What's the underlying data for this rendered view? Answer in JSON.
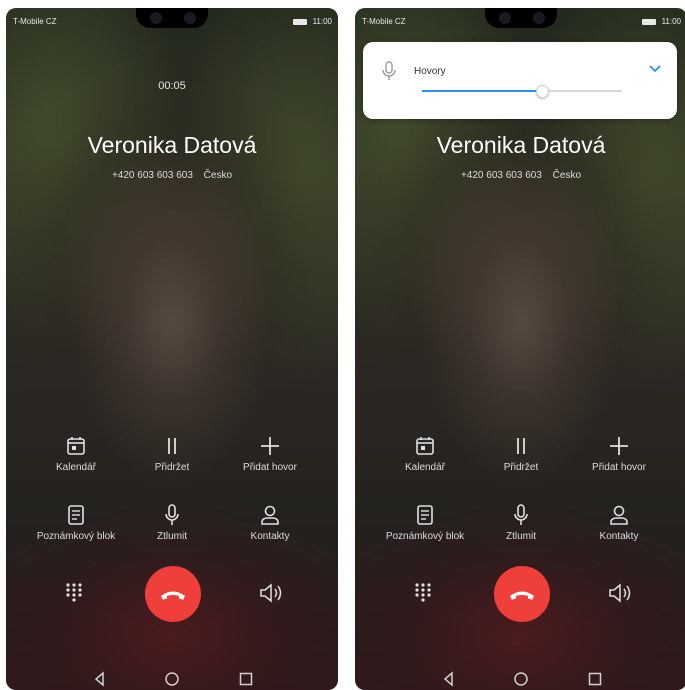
{
  "status": {
    "carrier": "T-Mobile CZ",
    "time": "11:00"
  },
  "call": {
    "timer": "00:05",
    "name": "Veronika Datová",
    "number": "+420 603 603 603",
    "country": "Česko"
  },
  "actions": {
    "calendar": "Kalendář",
    "hold": "Přidržet",
    "add_call": "Přidat hovor",
    "notepad": "Poznámkový blok",
    "mute": "Ztlumit",
    "contacts": "Kontakty"
  },
  "volume_popup": {
    "label": "Hovory",
    "level_percent": 60,
    "accent_color": "#2f8ef2"
  },
  "colors": {
    "end_call": "#ee3f3a"
  },
  "icons": [
    "calendar-icon",
    "pause-icon",
    "plus-icon",
    "notepad-icon",
    "microphone-icon",
    "person-icon",
    "dialpad-icon",
    "end-call-icon",
    "speaker-icon",
    "back-icon",
    "home-icon",
    "recents-icon",
    "chevron-down-icon"
  ]
}
